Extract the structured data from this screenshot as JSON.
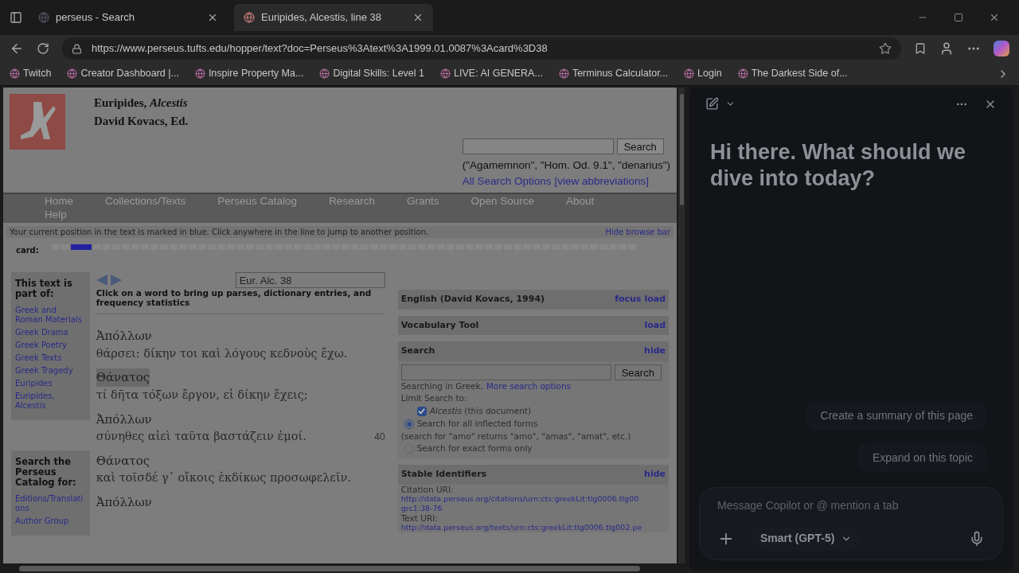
{
  "browser": {
    "tabs": [
      {
        "title": "perseus - Search",
        "selected": false
      },
      {
        "title": "Euripides, Alcestis, line 38",
        "selected": true
      }
    ],
    "address": "https://www.perseus.tufts.edu/hopper/text?doc=Perseus%3Atext%3A1999.01.0087%3Acard%3D38",
    "bookmarks": [
      "Twitch",
      "Creator Dashboard |...",
      "Inspire Property Ma...",
      "Digital Skills: Level 1",
      "LIVE: AI GENERA...",
      "Terminus Calculator...",
      "Login",
      "The Darkest Side of..."
    ]
  },
  "page": {
    "header": {
      "author": "Euripides,",
      "work": "Alcestis",
      "editor": "David Kovacs, Ed."
    },
    "search": {
      "button": "Search",
      "examples": "(\"Agamemnon\", \"Hom. Od. 9.1\", \"denarius\")",
      "options_link": "All Search Options",
      "abbrev_link": "[view abbreviations]"
    },
    "nav": [
      "Home",
      "Collections/Texts",
      "Perseus Catalog",
      "Research",
      "Grants",
      "Open Source",
      "About",
      "Help"
    ],
    "notice": {
      "text": "Your current position in the text is marked in blue. Click anywhere in the line to jump to another position.",
      "link": "Hide browse bar"
    },
    "browse_bar": {
      "label": "card:",
      "level": 0.03
    },
    "sidebar": [
      {
        "title": "This text is part of:",
        "links": [
          "Greek and Roman Materials",
          "Greek Drama",
          "Greek Poetry",
          "Greek Texts",
          "Greek Tragedy",
          "Euripides",
          "Euripides, Alcestis"
        ]
      },
      {
        "title": "Search the Perseus Catalog for:",
        "links": [
          "Editions/Translations",
          "Author Group"
        ]
      }
    ],
    "reader": {
      "citation": "Eur. Alc. 38",
      "instruction": "Click on a word to bring up parses, dictionary entries, and frequency statistics",
      "lines": [
        {
          "speaker": "Ἀπόλλων",
          "selected": false,
          "verse": "θάρσει: δίκην τοι καὶ λόγους κεδνοὺς ἔχω."
        },
        {
          "speaker": "Θάνατος",
          "selected": true,
          "verse": "τί δῆτα τόξων ἔργον, εἰ δίκην ἔχεις;"
        },
        {
          "speaker": "Ἀπόλλων",
          "selected": false,
          "verse": "σύνηθες αἰεὶ ταῦτα βαστάζειν ἐμοί.",
          "number": "40"
        },
        {
          "speaker": "Θάνατος",
          "selected": false,
          "verse": "καὶ τοῖσδέ γ᾽ οἴκοις ἐκδίκως προσωφελεῖν."
        },
        {
          "speaker": "Ἀπόλλων",
          "selected": false
        }
      ]
    },
    "panels": {
      "english": {
        "title": "English (David Kovacs, 1994)",
        "actions": [
          "focus",
          "load"
        ]
      },
      "vocab": {
        "title": "Vocabulary Tool",
        "actions": [
          "load"
        ]
      },
      "search": {
        "title": "Search",
        "action": "hide",
        "button": "Search",
        "note": "Searching in Greek.",
        "more": "More search options",
        "limit": "Limit Search to:",
        "doc_checked": true,
        "doc_title": "Alcestis",
        "doc_rest": "(this document)",
        "options": [
          {
            "label": "Search for all inflected forms",
            "hint": "(search for \"amo\" returns \"amo\", \"amas\", \"amat\", etc.)",
            "selected": true
          },
          {
            "label": "Search for exact forms only",
            "selected": false
          }
        ]
      },
      "ids": {
        "title": "Stable Identifiers",
        "action": "hide",
        "citation_label": "Citation URI:",
        "citation_uri": "http://data.perseus.org/citations/urn:cts:greekLit:tlg0006.tlg00",
        "citation_tail": "grc1:38-76",
        "text_label": "Text URI:",
        "text_uri": "http://data.perseus.org/texts/urn:cts:greekLit:tlg0006.tlg002.pe"
      }
    }
  },
  "copilot": {
    "greeting": "Hi there. What should we dive into today?",
    "suggestions": [
      "Create a summary of this page",
      "Expand on this topic"
    ],
    "placeholder": "Message Copilot or @ mention a tab",
    "model": "Smart (GPT-5)"
  }
}
